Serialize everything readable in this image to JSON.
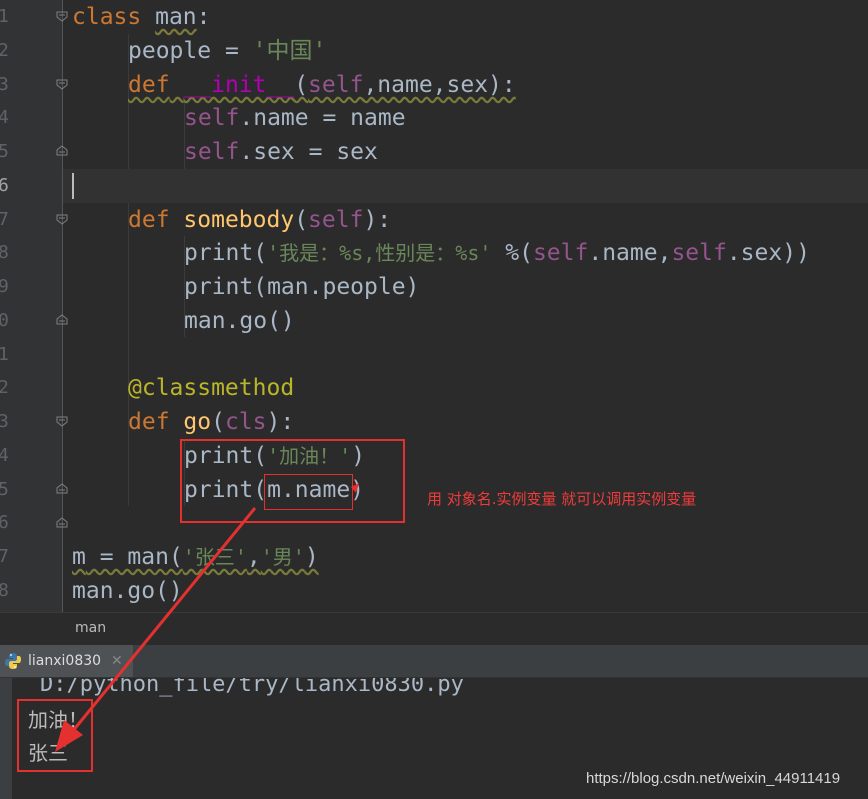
{
  "editor": {
    "line_numbers": [
      "1",
      "2",
      "3",
      "4",
      "5",
      "6",
      "7",
      "8",
      "9",
      "0",
      "1",
      "2",
      "3",
      "4",
      "5",
      "6",
      "7",
      "8"
    ],
    "lines": {
      "l1": {
        "kw": "class",
        "name": "man",
        "colon": ":"
      },
      "l2": {
        "var": "people",
        "eq": " = ",
        "str": "'中国'"
      },
      "l3": {
        "kw": "def",
        "sp": " ",
        "magic": "__init__",
        "rest1": "(",
        "self": "self",
        "rest2": ",name,sex):"
      },
      "l4": {
        "self": "self",
        "rest": ".name = name"
      },
      "l5": {
        "self": "self",
        "rest": ".sex = sex"
      },
      "l7": {
        "kw": "def",
        "sp": " ",
        "fn": "somebody",
        "p1": "(",
        "self": "self",
        "p2": "):"
      },
      "l8": {
        "print": "print",
        "p1": "(",
        "str": "'我是：%s,性别是：%s'",
        "mid": " %(",
        "self1": "self",
        "mid2": ".name,",
        "self2": "self",
        "end": ".sex))"
      },
      "l9": {
        "text": "print(man.people)"
      },
      "l10": {
        "text": "man.go()"
      },
      "l12": {
        "deco": "@classmethod"
      },
      "l13": {
        "kw": "def",
        "sp": " ",
        "fn": "go",
        "p1": "(",
        "cls": "cls",
        "p2": "):"
      },
      "l14": {
        "print": "print",
        "p1": "(",
        "str": "'加油！'",
        "p2": ")"
      },
      "l15": {
        "print": "print",
        "p1": "(",
        "inner": "m.name",
        "p2": ")"
      },
      "l17": {
        "a": "m",
        "b": " = man(",
        "s1": "'张三'",
        "c": ",",
        "s2": "'男'",
        "d": ")"
      },
      "l18": {
        "text": "man.go()"
      }
    }
  },
  "annotation": {
    "text": "用 对象名.实例变量 就可以调用实例变量",
    "color": "#e53030"
  },
  "breadcrumb": {
    "text": "man"
  },
  "run_tab": {
    "label": "lianxi0830",
    "close": "✕",
    "icon": "python-icon"
  },
  "console": {
    "path": "D:/python_file/try/lianxi0830.py",
    "output": [
      "加油！",
      "张三"
    ]
  },
  "watermark": "https://blog.csdn.net/weixin_44911419",
  "colors": {
    "background": "#2b2b2b",
    "keyword": "#cc7832",
    "string": "#6a8759",
    "self": "#94558d",
    "function": "#ffc66d",
    "decorator": "#bbb529"
  }
}
